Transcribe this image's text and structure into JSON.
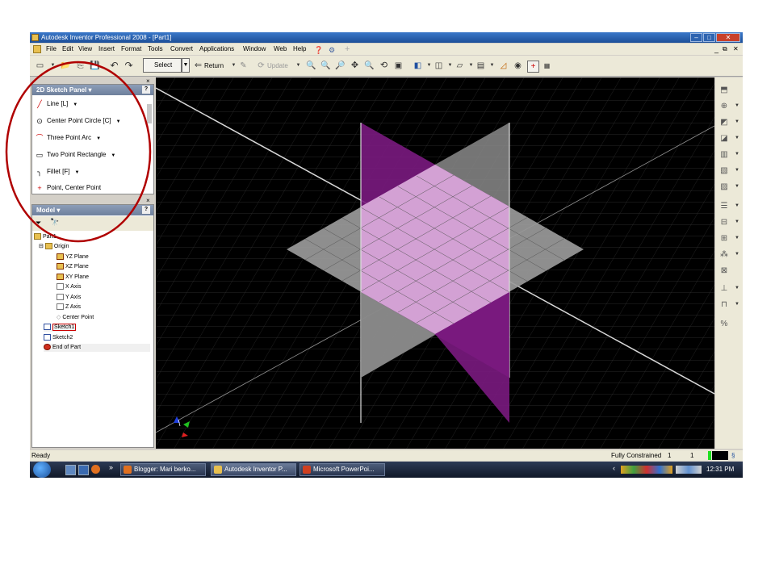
{
  "window": {
    "title": "Autodesk Inventor Professional 2008 - [Part1]",
    "menu": [
      "File",
      "Edit",
      "View",
      "Insert",
      "Format",
      "Tools",
      "Convert",
      "Applications",
      "Window",
      "Web",
      "Help"
    ]
  },
  "toolbar": {
    "select_label": "Select",
    "return_label": "Return",
    "update_label": "Update"
  },
  "sketch_panel": {
    "title": "2D Sketch Panel",
    "items": [
      {
        "label": "Line   [L]"
      },
      {
        "label": "Center Point Circle   [C]"
      },
      {
        "label": "Three Point Arc"
      },
      {
        "label": "Two Point Rectangle"
      },
      {
        "label": "Fillet   [F]"
      },
      {
        "label": "Point, Center Point"
      }
    ]
  },
  "model_panel": {
    "title": "Model",
    "tree": {
      "part": "Part1",
      "origin": "Origin",
      "yz": "YZ Plane",
      "xz": "XZ Plane",
      "xy": "XY Plane",
      "xaxis": "X Axis",
      "yaxis": "Y Axis",
      "zaxis": "Z Axis",
      "center": "Center Point",
      "sketch1": "Sketch1",
      "sketch2": "Sketch2",
      "end": "End of Part"
    }
  },
  "status": {
    "left": "Ready",
    "constraint": "Fully Constrained",
    "n1": "1",
    "n2": "1"
  },
  "taskbar": {
    "tasks": [
      "Blogger: Mari berko...",
      "Autodesk Inventor P...",
      "Microsoft PowerPoi..."
    ],
    "clock": "12:31 PM"
  },
  "colors": {
    "viewport_bg": "#000000",
    "plane_gray": "#9a9a9a",
    "plane_purple": "#7a1a80",
    "plane_pink": "#d8a8d8",
    "annotation_circle": "#b00000"
  }
}
